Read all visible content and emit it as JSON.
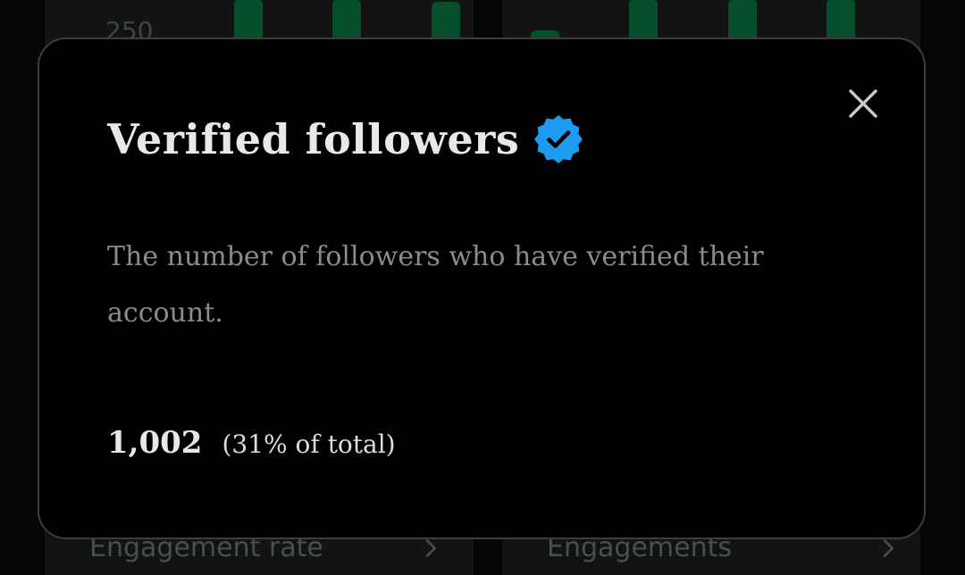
{
  "background": {
    "chart_tick_label": "250",
    "cards": [
      {
        "label": "Engagement rate"
      },
      {
        "label": "Engagements"
      }
    ]
  },
  "modal": {
    "title": "Verified followers",
    "description": "The number of followers who have verified their account.",
    "stat_value": "1,002",
    "stat_note": "(31% of total)",
    "icons": {
      "badge": "verified-badge-icon",
      "close": "close-icon"
    }
  },
  "colors": {
    "badge": "#1d9bf0",
    "chart_bar": "#00ba7c",
    "modal_background": "#000000"
  }
}
